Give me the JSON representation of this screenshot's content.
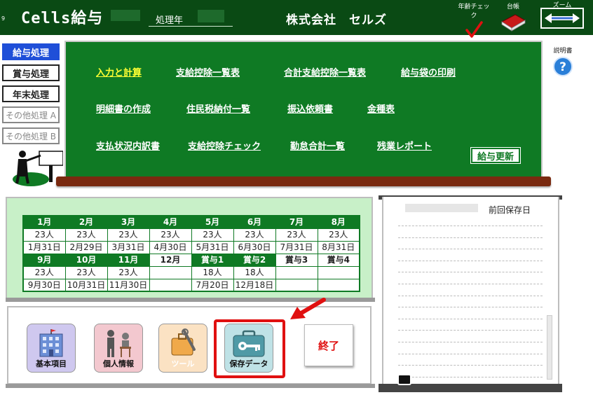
{
  "header": {
    "num_label": "9",
    "app_title": "Cells給与",
    "year_label": "処理年",
    "company": "株式会社　セルズ",
    "tools": {
      "age_check": "年齢チェック",
      "ledger": "台帳",
      "zoom": "ズーム"
    },
    "colors": {
      "background": "#0a4a14",
      "check": "#e01010"
    }
  },
  "help": {
    "label": "説明書",
    "icon": "question-mark-icon"
  },
  "nav": [
    {
      "label": "給与処理",
      "state": "active"
    },
    {
      "label": "賞与処理",
      "state": "normal"
    },
    {
      "label": "年末処理",
      "state": "normal"
    },
    {
      "label": "その他処理 A",
      "state": "disabled"
    },
    {
      "label": "その他処理 B",
      "state": "disabled"
    }
  ],
  "menu": {
    "row1": [
      "入力と計算",
      "支給控除一覧表",
      "合計支給控除一覧表",
      "給与袋の印刷"
    ],
    "row2": [
      "明細書の作成",
      "住民税納付一覧",
      "振込依頼書",
      "金種表"
    ],
    "row3": [
      "支払状況内訳書",
      "支給控除チェック",
      "勤怠合計一覧",
      "残業レポート"
    ],
    "update_button": "給与更新"
  },
  "calendar": {
    "row1": [
      {
        "month": "1月",
        "count": "23人",
        "date": "1月31日"
      },
      {
        "month": "2月",
        "count": "23人",
        "date": "2月29日"
      },
      {
        "month": "3月",
        "count": "23人",
        "date": "3月31日"
      },
      {
        "month": "4月",
        "count": "23人",
        "date": "4月30日"
      },
      {
        "month": "5月",
        "count": "23人",
        "date": "5月31日"
      },
      {
        "month": "6月",
        "count": "23人",
        "date": "6月30日"
      },
      {
        "month": "7月",
        "count": "23人",
        "date": "7月31日"
      },
      {
        "month": "8月",
        "count": "23人",
        "date": "8月31日"
      }
    ],
    "row2": [
      {
        "month": "9月",
        "count": "23人",
        "date": "9月30日",
        "header_style": "green"
      },
      {
        "month": "10月",
        "count": "23人",
        "date": "10月31日",
        "header_style": "green"
      },
      {
        "month": "11月",
        "count": "23人",
        "date": "11月30日",
        "header_style": "green"
      },
      {
        "month": "12月",
        "count": "",
        "date": "",
        "header_style": "white"
      },
      {
        "month": "賞与1",
        "count": "18人",
        "date": "7月20日",
        "header_style": "green"
      },
      {
        "month": "賞与2",
        "count": "18人",
        "date": "12月18日",
        "header_style": "green"
      },
      {
        "month": "賞与3",
        "count": "",
        "date": "",
        "header_style": "white"
      },
      {
        "month": "賞与4",
        "count": "",
        "date": "",
        "header_style": "white"
      }
    ]
  },
  "buttons": {
    "basic_items": "基本項目",
    "personal_info": "個人情報",
    "tools": "ツール",
    "save_data": "保存データ",
    "exit": "終了"
  },
  "log": {
    "last_saved_label": "前回保存日"
  }
}
